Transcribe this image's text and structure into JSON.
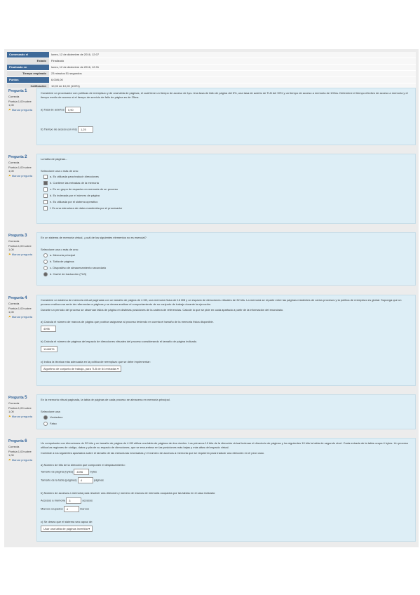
{
  "summary": [
    {
      "label": "Comenzado el",
      "value": "lunes, 12 de diciembre de 2016, 12:07",
      "dark": true
    },
    {
      "label": "Estado",
      "value": "Finalizado",
      "dark": false
    },
    {
      "label": "Finalizado en",
      "value": "lunes, 12 de diciembre de 2016, 12:31",
      "dark": true
    },
    {
      "label": "Tiempo empleado",
      "value": "23 minutos 51 segundos",
      "dark": false
    },
    {
      "label": "Puntos",
      "value": "6,00/6,00",
      "dark": true
    },
    {
      "label": "Calificación",
      "value": "10,00 de 10,00 (100%)",
      "dark": false
    }
  ],
  "questions": [
    {
      "number": "1",
      "state": "Correcta",
      "mark": "Puntúa 1,00 sobre 1,00",
      "flag": "Marcar pregunta",
      "text": "Considere un procesador con políticas de reemplazo y de una tabla de páginas, el cual tiene un tiempo de acceso de 1µs. Una tasa de fallo de página del 5%, una tasa de acierto de TLB del 90% y un tiempo de acceso a memoria de 100ns. Determine el tiempo efectivo de acceso a memoria y el tiempo medio de acceso si el tiempo de servicio de fallo de página es de 25ms.",
      "fields": [
        {
          "label": "a) Tasa de aciertos",
          "value": "0,90"
        },
        {
          "label": "b) Tiempo de acceso (en ms)",
          "value": "1,25"
        }
      ]
    },
    {
      "number": "2",
      "state": "Correcta",
      "mark": "Puntúa 1,00 sobre 1,00",
      "flag": "Marcar pregunta",
      "text": "La tabla de páginas...",
      "prompt": "Seleccione una o más de una:",
      "options": [
        {
          "label": "a. Es utilizada para traducir direcciones",
          "on": false
        },
        {
          "label": "b. Contiene las entradas de la memoria",
          "on": true
        },
        {
          "label": "c. Es un grupo de espacios en memoria de un proceso",
          "on": false
        },
        {
          "label": "d. Es indexada por el número de página",
          "on": false
        },
        {
          "label": "e. Es utilizada por el sistema operativo",
          "on": false
        },
        {
          "label": "f. Es una estructura de datos mantenida por el procesador",
          "on": false
        }
      ]
    },
    {
      "number": "3",
      "state": "Correcta",
      "mark": "Puntúa 1,00 sobre 1,00",
      "flag": "Marcar pregunta",
      "text": "En un sistema de memoria virtual, ¿cuál de los siguientes elementos no es esencial?",
      "prompt": "Seleccione una o más de una:",
      "options": [
        {
          "label": "a. Memoria principal",
          "on": false
        },
        {
          "label": "b. Tabla de páginas",
          "on": false
        },
        {
          "label": "c. Dispositivo de almacenamiento secundario",
          "on": false
        },
        {
          "label": "d. Caché de traducción (TLB)",
          "on": true
        }
      ]
    },
    {
      "number": "4",
      "state": "Correcta",
      "mark": "Puntúa 1,00 sobre 1,00",
      "flag": "Marcar pregunta",
      "text": "Considere un sistema de memoria virtual paginada con un tamaño de página de 4 KB, una memoria física de 16 MB y un espacio de direcciones virtuales de 32 bits. La memoria se reparte entre las páginas residentes de varios procesos y la política de reemplazo es global. Suponga que un proceso realiza una serie de referencias a páginas y se desea analizar el comportamiento de su conjunto de trabajo durante la ejecución.",
      "text2": "Durante un período del proceso se observan fallos de página en distintas posiciones de la cadena de referencias. Calcule lo que se pide en cada apartado a partir de la información del enunciado.",
      "fields": [
        {
          "label": "a) Calcula el número de marcos de página que podrían asignarse al proceso teniendo en cuenta el tamaño de la memoria física disponible.",
          "value": "4096"
        },
        {
          "label": "b) Calcula el número de páginas del espacio de direcciones virtuales del proceso considerando el tamaño de página indicado.",
          "value": "1048576"
        }
      ],
      "select_label": "c) Indica la técnica más adecuada en la política de reemplazo que se debe implementar:",
      "select_value": "Algoritmo de conjunto de trabajo, para TLB de 64 entradas"
    },
    {
      "number": "5",
      "state": "Correcta",
      "mark": "Puntúa 1,00 sobre 1,00",
      "flag": "Marcar pregunta",
      "text": "En la memoria virtual paginada, la tabla de páginas de cada proceso se almacena en memoria principal.",
      "prompt": "Seleccione una:",
      "options": [
        {
          "label": "Verdadero",
          "on": true
        },
        {
          "label": "Falso",
          "on": false
        }
      ]
    },
    {
      "number": "6",
      "state": "Correcta",
      "mark": "Puntúa 1,00 sobre 1,00",
      "flag": "Marcar pregunta",
      "text": "Un computador con direcciones de 32 bits y un tamaño de página de 4 KB utiliza una tabla de páginas de dos niveles. Los primeros 10 bits de la dirección virtual indexan el directorio de páginas y los siguientes 10 bits la tabla de segundo nivel. Cada entrada de la tabla ocupa 4 bytes. Un proceso utiliza las regiones de código, datos y pila de su espacio de direcciones, que se encuentran en las posiciones más bajas y más altas del espacio virtual.",
      "text2": "Conteste a los siguientes apartados sobre el tamaño de las estructuras necesarias y el número de accesos a memoria que se requieren para traducir una dirección en el peor caso.",
      "subq1": "a) Número de bits de la dirección que componen el desplazamiento:",
      "fields_a": [
        {
          "label": "Tamaño de página (bytes)",
          "value": "4096",
          "unit": "bytes"
        },
        {
          "label": "Tamaño de la tabla (páginas)",
          "value": "4",
          "unit": "páginas"
        }
      ],
      "subq2": "b) Número de accesos a memoria para resolver una dirección y número de marcos de memoria ocupados por las tablas en el caso indicado:",
      "fields_b": [
        {
          "label": "Accesos a memoria",
          "value": "3",
          "unit": "accesos"
        },
        {
          "label": "Marcos ocupados",
          "value": "4",
          "unit": "marcos"
        }
      ],
      "select_label": "c) Se desea que el sistema sea capaz de:",
      "select_value": "Usar una tabla de páginas invertida"
    }
  ]
}
